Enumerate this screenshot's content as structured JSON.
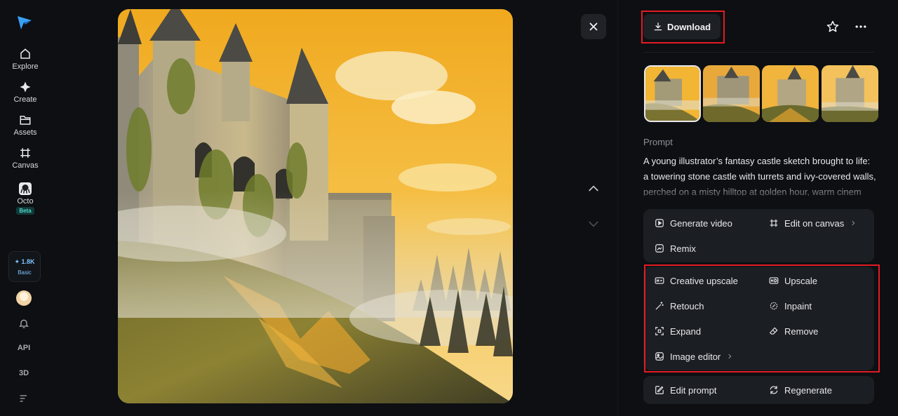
{
  "sidebar": {
    "items": [
      {
        "label": "Explore"
      },
      {
        "label": "Create"
      },
      {
        "label": "Assets"
      },
      {
        "label": "Canvas"
      },
      {
        "label": "Octo",
        "badge": "Beta"
      }
    ],
    "credits": {
      "amount": "✦ 1.8K",
      "plan": "Basic"
    },
    "api_label": "API",
    "three_d_label": "3D"
  },
  "toolbar": {
    "download_label": "Download"
  },
  "thumbnails": [
    {
      "name": "variation-1",
      "selected": true
    },
    {
      "name": "variation-2",
      "selected": false
    },
    {
      "name": "variation-3",
      "selected": false
    },
    {
      "name": "variation-4",
      "selected": false
    }
  ],
  "prompt": {
    "label": "Prompt",
    "text": "A young illustrator’s fantasy castle sketch brought to life: a towering stone castle with turrets and ivy-covered walls, perched on a misty hilltop at golden hour, warm cinem"
  },
  "actions": {
    "primary": [
      {
        "label": "Generate video",
        "icon": "play-icon"
      },
      {
        "label": "Edit on canvas",
        "icon": "crop-icon"
      },
      {
        "label": "Remix",
        "icon": "remix-icon"
      }
    ],
    "tools": [
      {
        "label": "Creative upscale",
        "icon": "hd-plus-icon"
      },
      {
        "label": "Upscale",
        "icon": "hd-icon"
      },
      {
        "label": "Retouch",
        "icon": "magic-wand-icon"
      },
      {
        "label": "Inpaint",
        "icon": "inpaint-icon"
      },
      {
        "label": "Expand",
        "icon": "expand-icon"
      },
      {
        "label": "Remove",
        "icon": "eraser-icon"
      },
      {
        "label": "Image editor",
        "icon": "image-edit-icon"
      }
    ],
    "bottom": [
      {
        "label": "Edit prompt",
        "icon": "edit-prompt-icon"
      },
      {
        "label": "Regenerate",
        "icon": "regenerate-icon"
      }
    ]
  },
  "colors": {
    "background": "#0d0f12",
    "panel": "#1b1e23",
    "highlight": "#e31b23",
    "accent": "#4aa8ff"
  }
}
